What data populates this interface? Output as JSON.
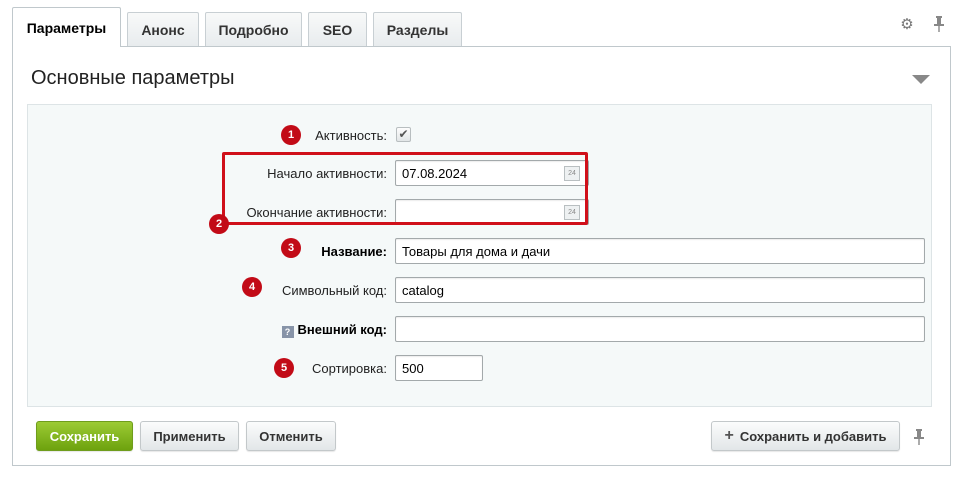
{
  "tabs": [
    {
      "label": "Параметры",
      "active": true
    },
    {
      "label": "Анонс",
      "active": false
    },
    {
      "label": "Подробно",
      "active": false
    },
    {
      "label": "SEO",
      "active": false
    },
    {
      "label": "Разделы",
      "active": false
    }
  ],
  "tab_tools": {
    "settings_icon": "gear-icon",
    "pin_icon": "pin-icon"
  },
  "panel": {
    "title": "Основные параметры"
  },
  "form": {
    "active": {
      "label": "Активность:",
      "checked": true,
      "badge": "1"
    },
    "active_from": {
      "label": "Начало активности:",
      "value": "07.08.2024",
      "calendar_day": "24"
    },
    "active_to": {
      "label": "Окончание активности:",
      "value": "",
      "calendar_day": "24",
      "badge": "2"
    },
    "name": {
      "label": "Название:",
      "value": "Товары для дома и дачи",
      "badge": "3"
    },
    "code": {
      "label": "Символьный код:",
      "value": "catalog",
      "badge": "4"
    },
    "xml_id": {
      "label": "Внешний код:",
      "value": "",
      "help": "?"
    },
    "sort": {
      "label": "Сортировка:",
      "value": "500",
      "badge": "5"
    }
  },
  "buttons": {
    "save": "Сохранить",
    "apply": "Применить",
    "cancel": "Отменить",
    "save_and_add": "Сохранить и добавить"
  },
  "colors": {
    "accent_green": "#7cb11b",
    "badge_red": "#c20b17",
    "highlight_red": "#d0101a"
  }
}
